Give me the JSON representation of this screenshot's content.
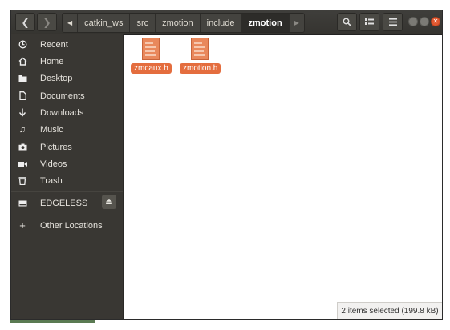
{
  "breadcrumb": {
    "items": [
      "catkin_ws",
      "src",
      "zmotion",
      "include",
      "zmotion"
    ],
    "active_index": 4
  },
  "sidebar": {
    "places": [
      {
        "label": "Recent",
        "icon": "clock-icon"
      },
      {
        "label": "Home",
        "icon": "home-icon"
      },
      {
        "label": "Desktop",
        "icon": "folder-icon"
      },
      {
        "label": "Documents",
        "icon": "document-icon"
      },
      {
        "label": "Downloads",
        "icon": "download-icon"
      },
      {
        "label": "Music",
        "icon": "music-icon"
      },
      {
        "label": "Pictures",
        "icon": "camera-icon"
      },
      {
        "label": "Videos",
        "icon": "video-icon"
      },
      {
        "label": "Trash",
        "icon": "trash-icon"
      }
    ],
    "device": {
      "label": "EDGELESS",
      "icon": "drive-icon"
    },
    "other": {
      "label": "Other Locations",
      "icon": "plus-icon"
    }
  },
  "files": [
    {
      "name": "zmcaux.h",
      "selected": true
    },
    {
      "name": "zmotion.h",
      "selected": true
    }
  ],
  "status": {
    "text": "2 items selected (199.8 kB)"
  },
  "colors": {
    "accent": "#e46d3e",
    "sidebar_bg": "#393733",
    "header_bg": "#3b3a36"
  }
}
